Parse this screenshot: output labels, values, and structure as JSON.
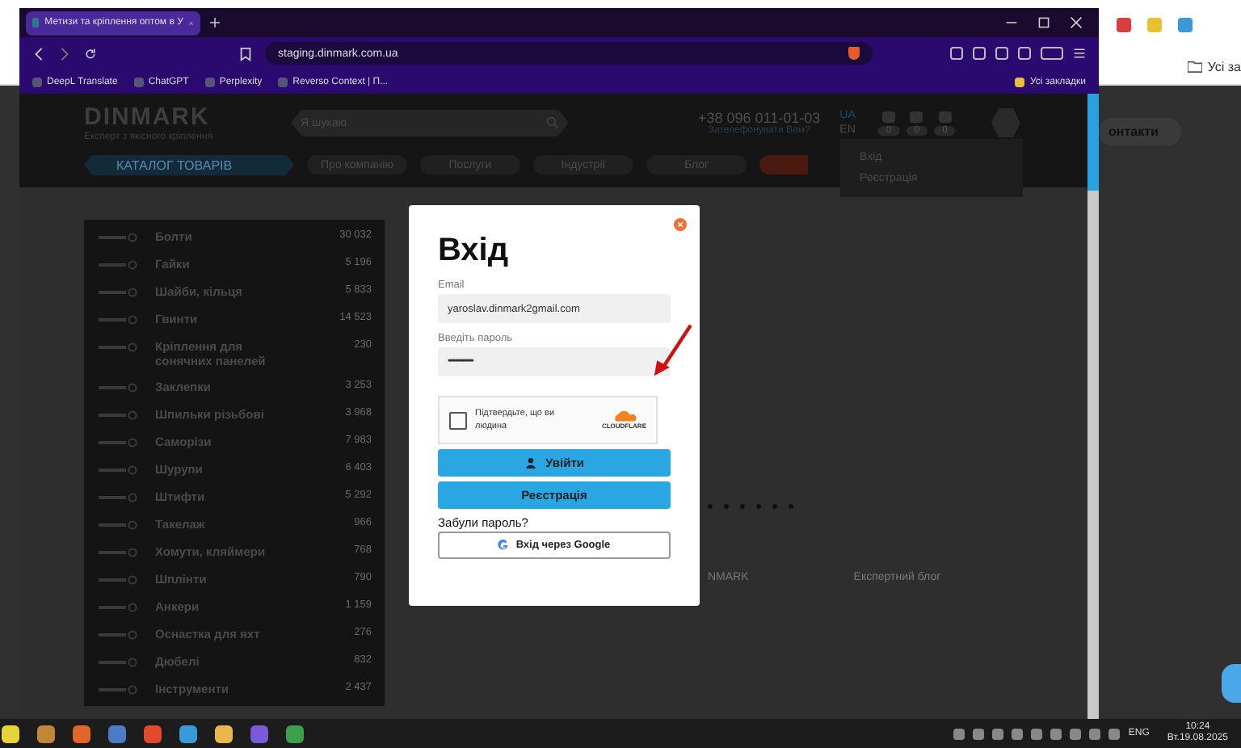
{
  "background_window": {
    "bookmark_text": "Усі за",
    "nav_text": "онтакти"
  },
  "browser": {
    "tab_title": "Метизи та кріплення оптом в У",
    "url": "staging.dinmark.com.ua",
    "bookmarks": [
      {
        "label": "DeepL Translate"
      },
      {
        "label": "ChatGPT"
      },
      {
        "label": "Perplexity"
      },
      {
        "label": "Reverso Context | П..."
      }
    ],
    "all_bookmarks": "Усі закладки"
  },
  "page": {
    "logo": "DINMARK",
    "tagline": "Експерт з якісного кріплення",
    "search_placeholder": "Я шукаю",
    "phone": "+38 096 011-01-03",
    "callback": "Зателефонувати Вам?",
    "languages": [
      {
        "label": "UA",
        "selected": true
      },
      {
        "label": "EN",
        "selected": false
      }
    ],
    "counters": [
      "0",
      "0",
      "0"
    ],
    "nav": [
      {
        "label": "КАТАЛОГ ТОВАРІВ",
        "kind": "catalog"
      },
      {
        "label": "Про компанію",
        "kind": "link"
      },
      {
        "label": "Послуги",
        "kind": "link"
      },
      {
        "label": "Індустрії",
        "kind": "link"
      },
      {
        "label": "Блог",
        "kind": "link"
      }
    ],
    "account_menu": [
      "Вхід",
      "Реєстрація"
    ],
    "categories": [
      {
        "name": "Болти",
        "count": "30 032"
      },
      {
        "name": "Гайки",
        "count": "5 196"
      },
      {
        "name": "Шайби, кільця",
        "count": "5 833"
      },
      {
        "name": "Гвинти",
        "count": "14 523"
      },
      {
        "name": "Кріплення для сонячних панелей",
        "count": "230"
      },
      {
        "name": "Заклепки",
        "count": "3 253"
      },
      {
        "name": "Шпильки різьбові",
        "count": "3 968"
      },
      {
        "name": "Саморізи",
        "count": "7 983"
      },
      {
        "name": "Шурупи",
        "count": "6 403"
      },
      {
        "name": "Штифти",
        "count": "5 292"
      },
      {
        "name": "Такелаж",
        "count": "966"
      },
      {
        "name": "Хомути, кляймери",
        "count": "768"
      },
      {
        "name": "Шплінти",
        "count": "790"
      },
      {
        "name": "Анкери",
        "count": "1 159"
      },
      {
        "name": "Оснастка для яхт",
        "count": "276"
      },
      {
        "name": "Дюбелі",
        "count": "832"
      },
      {
        "name": "Інструменти",
        "count": "2 437"
      }
    ],
    "bottom_labels": [
      "NMARK",
      "Експертний блог"
    ]
  },
  "modal": {
    "title": "Вхід",
    "email_label": "Email",
    "email_value": "yaroslav.dinmark2gmail.com",
    "password_label": "Введіть пароль",
    "password_value": "••••••••••••••",
    "captcha": {
      "text": "Підтвердьте, що ви людина",
      "checked": false,
      "brand": "CLOUDFLARE"
    },
    "login_button": "Увійти",
    "register_button": "Реєстрація",
    "forgot_link": "Забули пароль?",
    "google_button": "Вхід через Google"
  },
  "taskbar": {
    "language": "ENG",
    "time": "10:24",
    "date": "Вт.19.08.2025"
  }
}
